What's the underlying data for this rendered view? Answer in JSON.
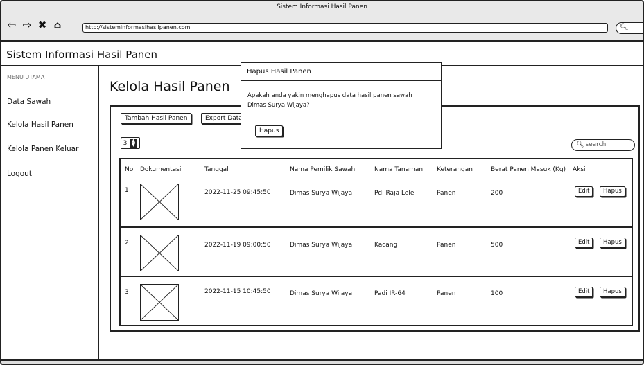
{
  "window": {
    "title": "Sistem Informasi Hasil Panen"
  },
  "browser": {
    "url": "http://sisteminformasihasilpanen.com",
    "icons": [
      "back-arrow-icon",
      "forward-arrow-icon",
      "close-icon",
      "home-icon"
    ]
  },
  "app": {
    "title": "Sistem Informasi Hasil Panen"
  },
  "sidebar": {
    "heading": "MENU UTAMA",
    "items": [
      {
        "label": "Data Sawah"
      },
      {
        "label": "Kelola Hasil Panen"
      },
      {
        "label": "Kelola Panen Keluar"
      },
      {
        "label": "Logout"
      }
    ]
  },
  "page": {
    "title": "Kelola Hasil Panen",
    "add_button": "Tambah Hasil Panen",
    "export_button": "Export Data",
    "page_size": "3",
    "search_placeholder": "search"
  },
  "table": {
    "columns": [
      "No",
      "Dokumentasi",
      "Tanggal",
      "Nama Pemilik Sawah",
      "Nama Tanaman",
      "Keterangan",
      "Berat Panen Masuk (Kg)",
      "Aksi"
    ],
    "rows": [
      {
        "no": "1",
        "tanggal": "2022-11-25 09:45:50",
        "pemilik": "Dimas Surya Wijaya",
        "tanaman": "Pdi Raja Lele",
        "keterangan": "Panen",
        "berat": "200"
      },
      {
        "no": "2",
        "tanggal": "2022-11-19 09:00:50",
        "pemilik": "Dimas Surya Wijaya",
        "tanaman": "Kacang",
        "keterangan": "Panen",
        "berat": "500"
      },
      {
        "no": "3",
        "tanggal": "2022-11-15 10:45:50",
        "pemilik": "Dimas Surya Wijaya",
        "tanaman": "Padi IR-64",
        "keterangan": "Panen",
        "berat": "100"
      }
    ],
    "edit_label": "Edit",
    "delete_label": "Hapus"
  },
  "dialog": {
    "title": "Hapus Hasil Panen",
    "message": "Apakah anda yakin menghapus data hasil panen sawah Dimas Surya Wijaya?",
    "confirm_label": "Hapus"
  }
}
